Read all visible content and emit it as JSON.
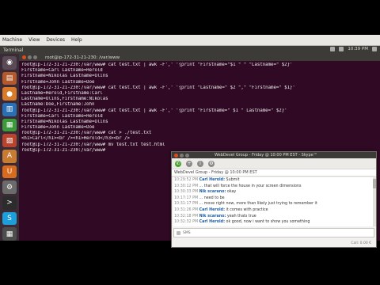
{
  "vm_menubar": {
    "items": [
      "Machine",
      "View",
      "Devices",
      "Help"
    ]
  },
  "top_panel": {
    "title": "Terminal",
    "clock": "10:39 PM"
  },
  "launcher": {
    "icons": [
      "dash-icon",
      "files-icon",
      "firefox-icon",
      "libreoffice-writer-icon",
      "libreoffice-calc-icon",
      "libreoffice-impress-icon",
      "software-center-icon",
      "ubuntu-one-icon",
      "settings-icon",
      "terminal-icon",
      "skype-icon",
      "workspace-icon",
      "trash-icon"
    ]
  },
  "terminal": {
    "title": "root@ip-172-31-21-230: /var/www",
    "lines": [
      "root@ip-172-31-21-230:/var/www# cat test.txt | awk -F',' '{print \"Firstname=\"$1 \" \" \"Lastname=\" $2}'",
      "Firstname=Carl Lastname=Herold",
      "Firstname=Nikolas Lastname=Olins",
      "Firstname=John Lastname=Doe",
      "root@ip-172-31-21-230:/var/www# cat test.txt | awk -F',' '{print \"Lastname=\" $2 \",\" \"Firstname=\" $1}'",
      "Lastname=Herold,Firstname:Carl",
      "Lastname=Olins,Firstname:Nikolas",
      "Lastname:Doe,Firstname:John",
      "root@ip-172-31-21-230:/var/www# cat test.txt | awk -F',' '{print \"Firstname=\" $1 \" Lastname=\" $2}'",
      "Firstname=Carl Lastname=Herold",
      "Firstname=Nikolas Lastname=Olins",
      "Firstname=John Lastname=Doe",
      "root@ip-172-31-21-230:/var/www# cat > ./test.txt",
      "<h1>Carl</h1><br /><h1>Herold</h3><br />",
      "root@ip-172-31-21-230:/var/www# mv test.txt test.html",
      "root@ip-172-31-21-230:/var/www# "
    ]
  },
  "skype": {
    "title": "WebDevel Group - Friday @ 10:00 PM EST - Skype™",
    "header": "WebDevel Group - Friday @ 10:00 PM EST",
    "messages": [
      {
        "time": "10:29:52 PM",
        "author": "Carl Herold:",
        "text": "Submit"
      },
      {
        "time": "10:30:12 PM",
        "author": "",
        "text": "... that will force the house in your screen dimensions"
      },
      {
        "time": "10:30:33 PM",
        "author": "Nik scarano:",
        "text": "okay"
      },
      {
        "time": "10:17:17 PM",
        "author": "",
        "text": "... need to be"
      },
      {
        "time": "10:31:17 PM",
        "author": "",
        "text": "... move right now, more than likely just trying to remember it"
      },
      {
        "time": "10:31:26 PM",
        "author": "Carl Herold:",
        "text": "it comes with practice"
      },
      {
        "time": "10:32:18 PM",
        "author": "Nik scarano:",
        "text": "yeah thats true"
      },
      {
        "time": "10:32:32 PM",
        "author": "Carl Herold:",
        "text": "ok good, now i want to show you something"
      }
    ],
    "input_label": "SMS",
    "status": "Call: 0.00 €"
  }
}
